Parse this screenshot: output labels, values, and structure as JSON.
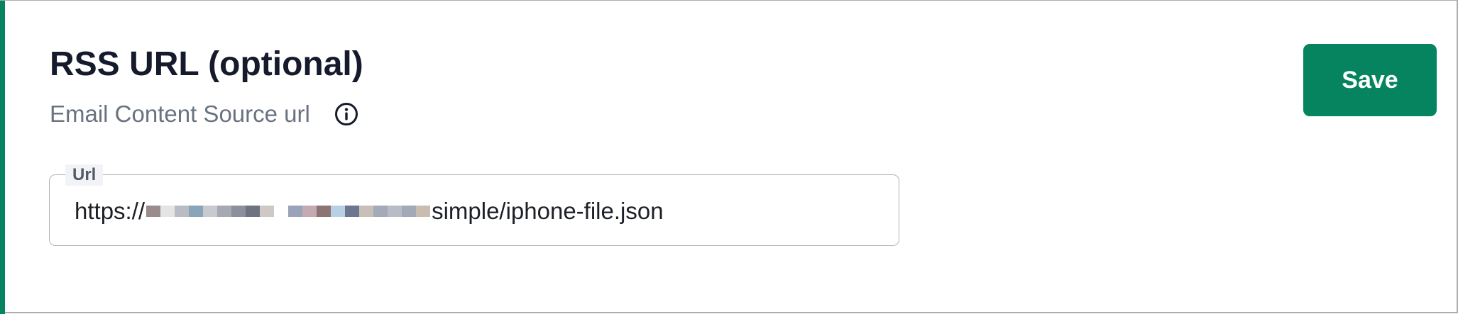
{
  "section": {
    "title": "RSS URL (optional)",
    "subtitle": "Email Content Source url",
    "info_icon": "info-circle-icon"
  },
  "actions": {
    "save_label": "Save"
  },
  "url_field": {
    "label": "Url",
    "value_prefix": "https://",
    "value_suffix": "simple/iphone-file.json"
  },
  "colors": {
    "accent": "#06845f",
    "title_text": "#151a2d",
    "subtitle_text": "#697280",
    "field_border": "#b1b4b9"
  }
}
